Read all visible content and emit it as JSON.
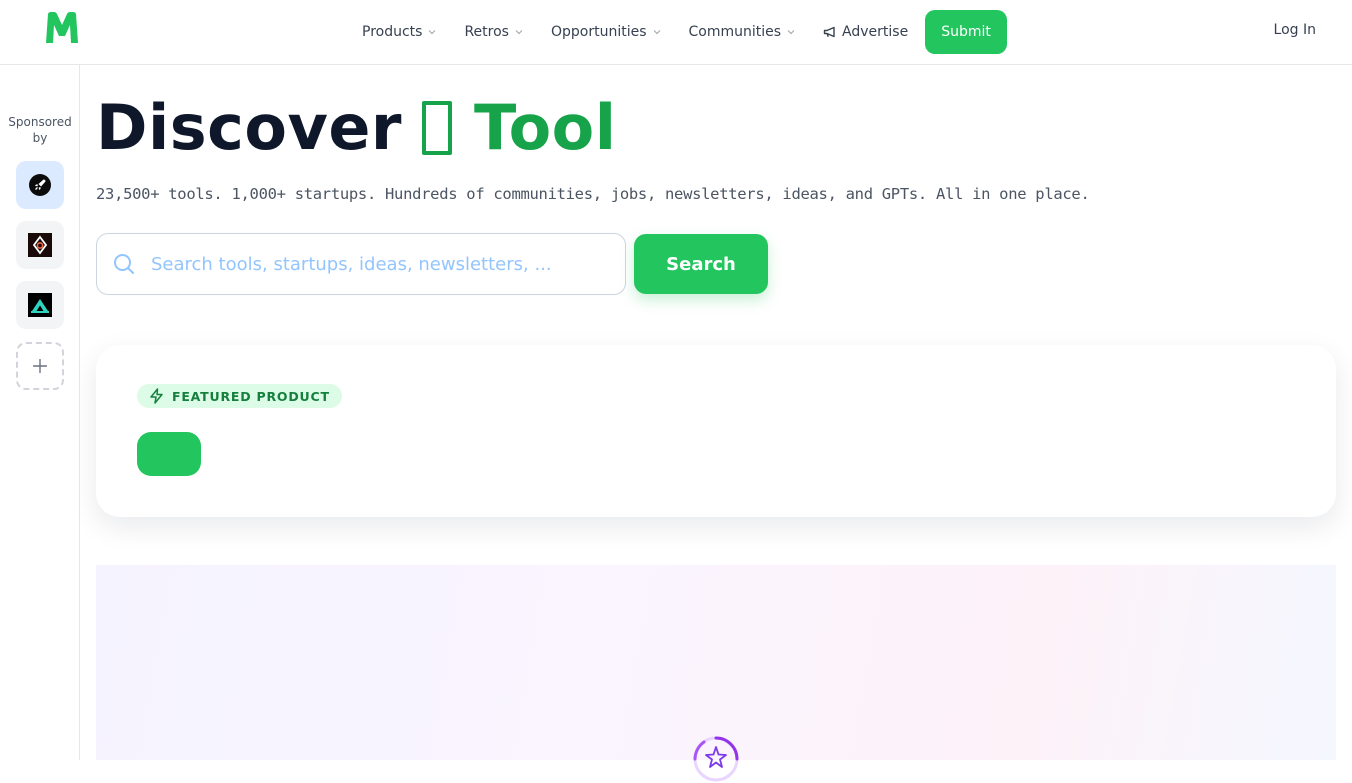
{
  "nav": {
    "products": "Products",
    "retros": "Retros",
    "opportunities": "Opportunities",
    "communities": "Communities",
    "advertise": "Advertise",
    "submit": "Submit",
    "login": "Log In"
  },
  "brand": {
    "accent": "#22c55e",
    "logo_letter": "M"
  },
  "sidebar": {
    "sponsored_label": "Sponsored by",
    "sponsors": [
      {
        "icon": "rocket-icon"
      },
      {
        "icon": "drop-logo-icon"
      },
      {
        "icon": "triangle-logo-icon"
      }
    ],
    "add_icon": "plus-icon"
  },
  "hero": {
    "title_word1": "Discover",
    "title_word2": "Tool",
    "subtitle": "23,500+ tools. 1,000+ startups. Hundreds of communities, jobs, newsletters, ideas, and GPTs. All in one place."
  },
  "search": {
    "placeholder": "Search tools, startups, ideas, newsletters, ...",
    "button": "Search"
  },
  "featured": {
    "badge": "FEATURED PRODUCT"
  }
}
